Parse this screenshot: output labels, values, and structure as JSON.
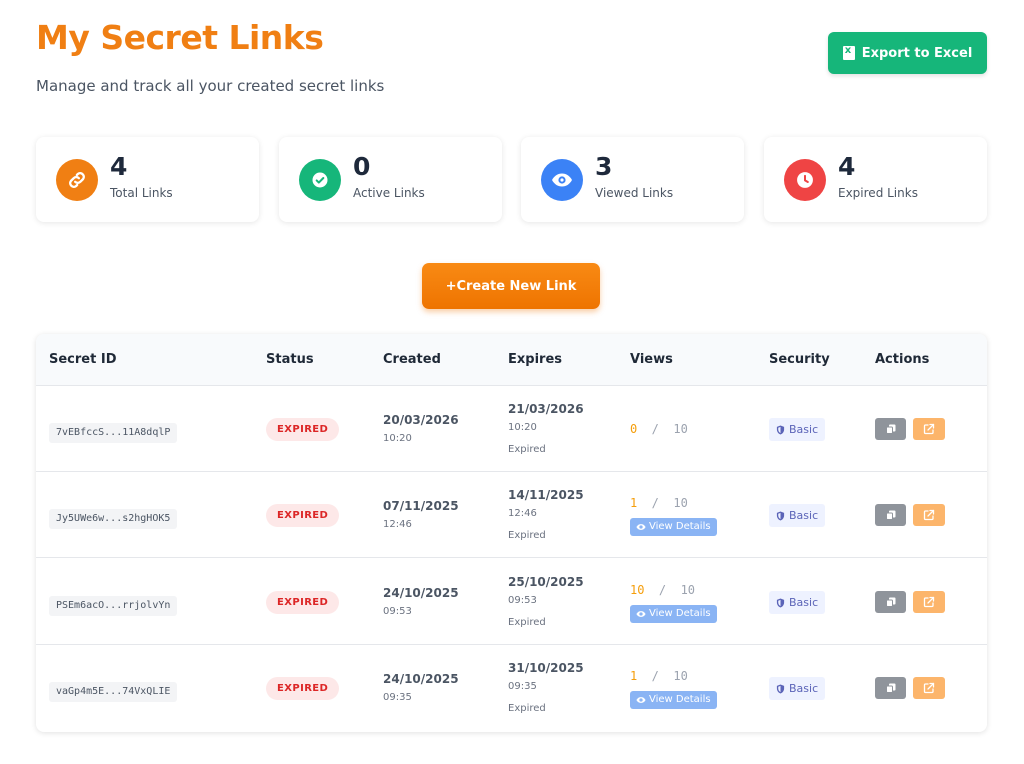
{
  "header": {
    "title": "My Secret Links",
    "subtitle": "Manage and track all your created secret links",
    "export_label": "Export to Excel",
    "export_icon": "excel-file-icon"
  },
  "stats": [
    {
      "value": "4",
      "label": "Total Links",
      "icon": "link-icon",
      "color": "#f07f13"
    },
    {
      "value": "0",
      "label": "Active Links",
      "icon": "check-circle-icon",
      "color": "#16b67a"
    },
    {
      "value": "3",
      "label": "Viewed Links",
      "icon": "eye-icon",
      "color": "#3b82f6"
    },
    {
      "value": "4",
      "label": "Expired Links",
      "icon": "clock-icon",
      "color": "#ef4444"
    }
  ],
  "create_button": {
    "label": "+Create New Link"
  },
  "table": {
    "headers": [
      "Secret ID",
      "Status",
      "Created",
      "Expires",
      "Views",
      "Security",
      "Actions"
    ],
    "rows": [
      {
        "id": "7vEBfccS...11A8dqlP",
        "status": "EXPIRED",
        "created_date": "20/03/2026",
        "created_time": "10:20",
        "expires_date": "21/03/2026",
        "expires_time": "10:20",
        "expires_note": "Expired",
        "views": "0",
        "views_max": "10",
        "view_details": "",
        "security": "Basic"
      },
      {
        "id": "Jy5UWe6w...s2hgHOK5",
        "status": "EXPIRED",
        "created_date": "07/11/2025",
        "created_time": "12:46",
        "expires_date": "14/11/2025",
        "expires_time": "12:46",
        "expires_note": "Expired",
        "views": "1",
        "views_max": "10",
        "view_details": "View Details",
        "security": "Basic"
      },
      {
        "id": "PSEm6acO...rrjolvYn",
        "status": "EXPIRED",
        "created_date": "24/10/2025",
        "created_time": "09:53",
        "expires_date": "25/10/2025",
        "expires_time": "09:53",
        "expires_note": "Expired",
        "views": "10",
        "views_max": "10",
        "view_details": "View Details",
        "security": "Basic"
      },
      {
        "id": "vaGp4m5E...74VxQLIE",
        "status": "EXPIRED",
        "created_date": "24/10/2025",
        "created_time": "09:35",
        "expires_date": "31/10/2025",
        "expires_time": "09:35",
        "expires_note": "Expired",
        "views": "1",
        "views_max": "10",
        "view_details": "View Details",
        "security": "Basic"
      }
    ]
  },
  "colors": {
    "brand_orange": "#f07f13",
    "export_green": "#16b67a",
    "expired_red": "#dc2626",
    "view_details_blue": "#8ab4f4"
  }
}
